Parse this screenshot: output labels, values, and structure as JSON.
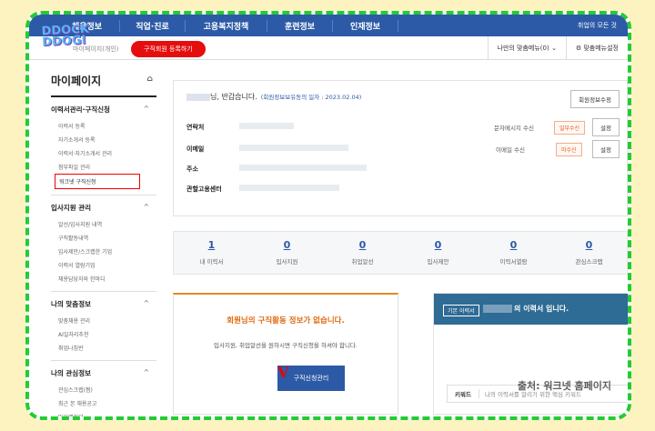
{
  "topnav": {
    "items": [
      "채용정보",
      "직업·진로",
      "고용복지정책",
      "훈련정보",
      "인재정보"
    ],
    "right": "취업의 모든 것"
  },
  "crumb": {
    "text": "마이페이지(개인)",
    "active": "구직회원 등록하기",
    "menu": "나만의 맞춤메뉴(0)",
    "settings": "맞춤메뉴설정"
  },
  "logo": {
    "line1": "DDOCK",
    "line2": "DDOGI"
  },
  "sidebar": {
    "title": "마이페이지",
    "groups": [
      {
        "title": "이력서관리·구직신청",
        "items": [
          "이력서 등록",
          "자기소개서 등록",
          "이력서·자기소개서 관리",
          "첨부파일 관리",
          "워크넷 구직신청"
        ]
      },
      {
        "title": "입사지원 관리",
        "items": [
          "알선/입사지원 내역",
          "구직활동내역",
          "입사제안/스크랩한 기업",
          "이력서 열람기업",
          "채용담당자와 한마디"
        ]
      },
      {
        "title": "나의 맞춤정보",
        "items": [
          "맞춤채용 관리",
          "AI일자리추천",
          "취업나침반"
        ]
      },
      {
        "title": "나의 관심정보",
        "items": [
          "관심스크랩(찜)",
          "최근 본 채용공고",
          "마이캘린더"
        ]
      }
    ]
  },
  "profile": {
    "greeting": "님, 반갑습니다.",
    "join_date": "(회원정보보유동의 일자 : 2023.02.04)",
    "edit_button": "회원정보수정",
    "labels": {
      "phone": "연락처",
      "email": "이메일",
      "address": "주소",
      "center": "관할고용센터"
    },
    "sms_label": "문자메시지 수신",
    "sms_status": "일부수신",
    "email_label": "이메일 수신",
    "email_status": "미수신",
    "set_button": "설정"
  },
  "stats": [
    {
      "num": "1",
      "label": "내 이력서"
    },
    {
      "num": "0",
      "label": "입사지원"
    },
    {
      "num": "0",
      "label": "취업알선"
    },
    {
      "num": "0",
      "label": "입사제안"
    },
    {
      "num": "0",
      "label": "이력서열람"
    },
    {
      "num": "0",
      "label": "관심스크랩"
    }
  ],
  "job_search": {
    "title": "회원님의 구직활동 정보가 없습니다.",
    "desc": "입사지원, 취업알선을 원하시면 구직신청을 하셔야 합니다.",
    "button": "구직신청관리",
    "mark": "V"
  },
  "resume": {
    "tag": "기본 이력서",
    "title": "의 이력서 입니다.",
    "keyword_label": "키워드",
    "keyword_value": "나의 이력서를 알리기 위한 핵심 키워드"
  },
  "watermark": "출처: 워크넷 홈페이지"
}
